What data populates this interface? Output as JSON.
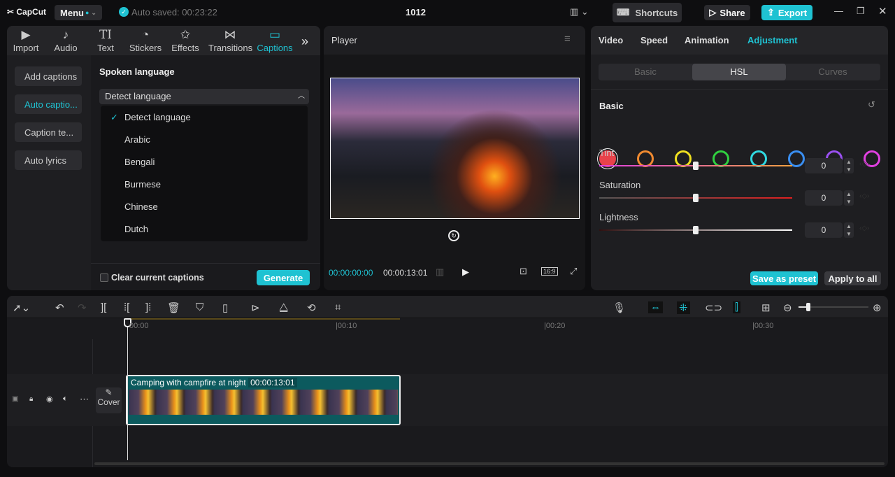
{
  "app": {
    "logo": "CapCut",
    "menu": "Menu",
    "autosave": "Auto saved: 00:23:22",
    "project_title": "1012",
    "shortcuts": "Shortcuts",
    "share": "Share",
    "export": "Export"
  },
  "media_tabs": [
    {
      "label": "Import",
      "icon": "▶"
    },
    {
      "label": "Audio",
      "icon": "♪"
    },
    {
      "label": "Text",
      "icon": "TI"
    },
    {
      "label": "Stickers",
      "icon": "◔"
    },
    {
      "label": "Effects",
      "icon": "✩"
    },
    {
      "label": "Transitions",
      "icon": "⋈"
    },
    {
      "label": "Captions",
      "icon": "▭"
    }
  ],
  "captions_sidebar": [
    "Add captions",
    "Auto captio...",
    "Caption te...",
    "Auto lyrics"
  ],
  "spoken_language": {
    "title": "Spoken language",
    "selected": "Detect language",
    "options": [
      "Detect language",
      "Arabic",
      "Bengali",
      "Burmese",
      "Chinese",
      "Dutch"
    ]
  },
  "clear_captions": "Clear current captions",
  "generate": "Generate",
  "player": {
    "title": "Player",
    "current_time": "00:00:00:00",
    "duration": "00:00:13:01",
    "ratio": "16:9"
  },
  "inspector": {
    "tabs": [
      "Video",
      "Speed",
      "Animation",
      "Adjustment"
    ],
    "active_tab": "Adjustment",
    "subtabs": [
      "Basic",
      "HSL",
      "Curves"
    ],
    "active_subtab": "HSL",
    "section": "Basic",
    "colors": [
      "#e8424a",
      "#f08a30",
      "#f0e020",
      "#30d040",
      "#30d8e0",
      "#3a8ef0",
      "#9a50f0",
      "#e040e0"
    ],
    "sliders": [
      {
        "label": "Tint",
        "value": "0"
      },
      {
        "label": "Saturation",
        "value": "0"
      },
      {
        "label": "Lightness",
        "value": "0"
      }
    ],
    "save_preset": "Save as preset",
    "apply_all": "Apply to all"
  },
  "accent": "#1fc2d2",
  "timeline": {
    "ticks": [
      "00:00",
      "00:10",
      "00:20",
      "00:30"
    ],
    "cover": "Cover",
    "clip_title": "Camping with campfire at night",
    "clip_duration": "00:00:13:01"
  }
}
